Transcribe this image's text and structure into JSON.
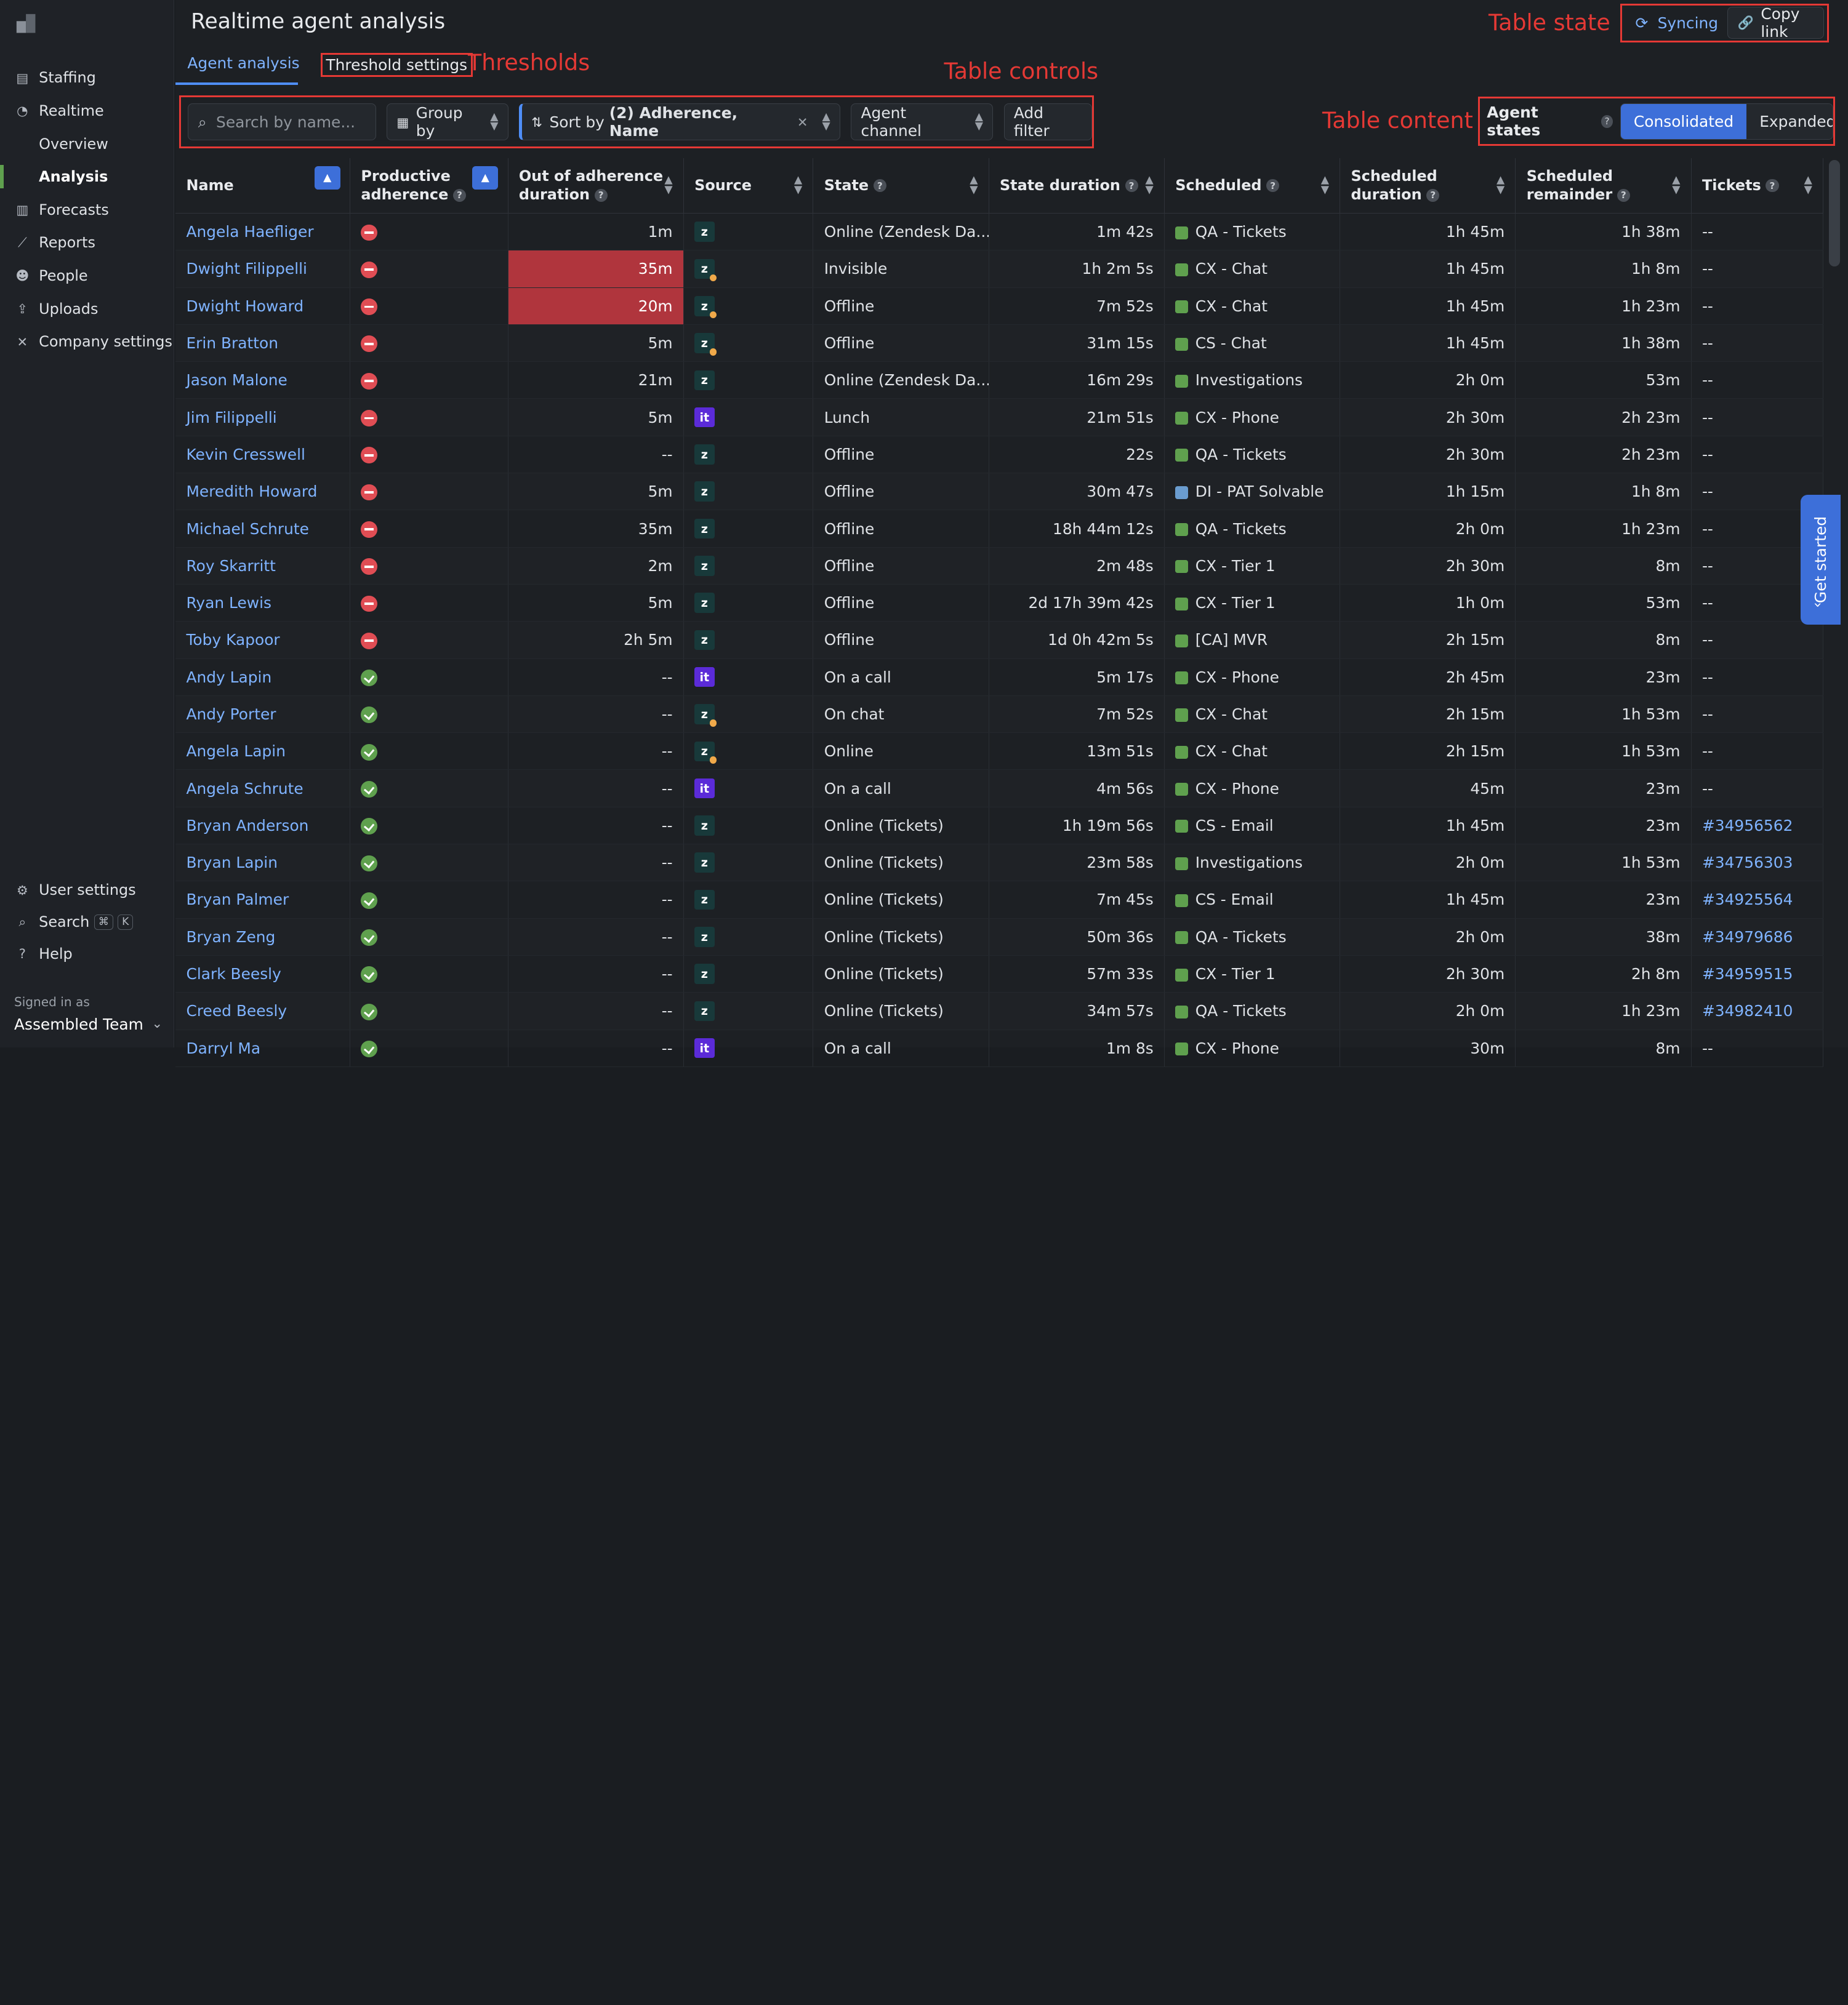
{
  "sidebar": {
    "items": [
      {
        "label": "Staffing",
        "icon": "staffing-icon",
        "glyph": "▤"
      },
      {
        "label": "Realtime",
        "icon": "gauge-icon",
        "glyph": "◔"
      },
      {
        "label": "Overview",
        "sub": true
      },
      {
        "label": "Analysis",
        "sub": true,
        "active": true
      },
      {
        "label": "Forecasts",
        "icon": "book-icon",
        "glyph": "▥"
      },
      {
        "label": "Reports",
        "icon": "chart-icon",
        "glyph": "⟋"
      },
      {
        "label": "People",
        "icon": "people-icon",
        "glyph": "☻"
      },
      {
        "label": "Uploads",
        "icon": "upload-icon",
        "glyph": "⇪"
      },
      {
        "label": "Company settings",
        "icon": "tools-icon",
        "glyph": "✕"
      }
    ],
    "bottom": {
      "user_settings": "User settings",
      "search": "Search",
      "search_kbd1": "⌘",
      "search_kbd2": "K",
      "help": "Help"
    },
    "signed_in_label": "Signed in as",
    "signed_in_name": "Assembled Team"
  },
  "header": {
    "title": "Realtime agent analysis",
    "tab_agent_analysis": "Agent analysis",
    "tab_threshold_settings": "Threshold settings",
    "syncing": "Syncing",
    "copy_link": "Copy link"
  },
  "annotations": {
    "thresholds": "Thresholds",
    "table_controls": "Table controls",
    "table_state": "Table state",
    "table_content": "Table content",
    "color": "#e53935"
  },
  "controls": {
    "search_placeholder": "Search by name...",
    "group_by": "Group by",
    "sort_prefix": "Sort by ",
    "sort_value": "(2) Adherence, Name",
    "agent_channel": "Agent channel",
    "add_filter": "Add filter"
  },
  "agent_states": {
    "label": "Agent states",
    "consolidated": "Consolidated",
    "expanded": "Expanded"
  },
  "table": {
    "headers": {
      "name": "Name",
      "productive_adherence": "Productive adherence",
      "out_of_adherence": "Out of adherence duration",
      "source": "Source",
      "state": "State",
      "state_duration": "State duration",
      "scheduled": "Scheduled",
      "scheduled_duration": "Scheduled duration",
      "scheduled_remainder": "Scheduled remainder",
      "tickets": "Tickets"
    },
    "rows": [
      {
        "name": "Angela Haefliger",
        "adh": "bad",
        "ooa": "1m",
        "hl": false,
        "src": "z",
        "state": "Online (Zendesk Da...",
        "dur": "1m 42s",
        "sched": "QA - Tickets",
        "sc": "green",
        "sdur": "1h 45m",
        "rem": "1h 38m",
        "tix": "--"
      },
      {
        "name": "Dwight Filippelli",
        "adh": "bad",
        "ooa": "35m",
        "hl": true,
        "src": "zs",
        "state": "Invisible",
        "dur": "1h 2m 5s",
        "sched": "CX - Chat",
        "sc": "green",
        "sdur": "1h 45m",
        "rem": "1h 8m",
        "tix": "--"
      },
      {
        "name": "Dwight Howard",
        "adh": "bad",
        "ooa": "20m",
        "hl": true,
        "src": "zs",
        "state": "Offline",
        "dur": "7m 52s",
        "sched": "CX - Chat",
        "sc": "green",
        "sdur": "1h 45m",
        "rem": "1h 23m",
        "tix": "--"
      },
      {
        "name": "Erin Bratton",
        "adh": "bad",
        "ooa": "5m",
        "hl": false,
        "src": "zs",
        "state": "Offline",
        "dur": "31m 15s",
        "sched": "CS - Chat",
        "sc": "green",
        "sdur": "1h 45m",
        "rem": "1h 38m",
        "tix": "--"
      },
      {
        "name": "Jason Malone",
        "adh": "bad",
        "ooa": "21m",
        "hl": false,
        "src": "z",
        "state": "Online (Zendesk Da...",
        "dur": "16m 29s",
        "sched": "Investigations",
        "sc": "green",
        "sdur": "2h 0m",
        "rem": "53m",
        "tix": "--"
      },
      {
        "name": "Jim Filippelli",
        "adh": "bad",
        "ooa": "5m",
        "hl": false,
        "src": "t",
        "state": "Lunch",
        "dur": "21m 51s",
        "sched": "CX - Phone",
        "sc": "green",
        "sdur": "2h 30m",
        "rem": "2h 23m",
        "tix": "--"
      },
      {
        "name": "Kevin Cresswell",
        "adh": "bad",
        "ooa": "--",
        "hl": false,
        "src": "z",
        "state": "Offline",
        "dur": "22s",
        "sched": "QA - Tickets",
        "sc": "green",
        "sdur": "2h 30m",
        "rem": "2h 23m",
        "tix": "--"
      },
      {
        "name": "Meredith Howard",
        "adh": "bad",
        "ooa": "5m",
        "hl": false,
        "src": "z",
        "state": "Offline",
        "dur": "30m 47s",
        "sched": "DI - PAT Solvable",
        "sc": "blue",
        "sdur": "1h 15m",
        "rem": "1h 8m",
        "tix": "--"
      },
      {
        "name": "Michael Schrute",
        "adh": "bad",
        "ooa": "35m",
        "hl": false,
        "src": "z",
        "state": "Offline",
        "dur": "18h 44m 12s",
        "sched": "QA - Tickets",
        "sc": "green",
        "sdur": "2h 0m",
        "rem": "1h 23m",
        "tix": "--"
      },
      {
        "name": "Roy Skarritt",
        "adh": "bad",
        "ooa": "2m",
        "hl": false,
        "src": "z",
        "state": "Offline",
        "dur": "2m 48s",
        "sched": "CX - Tier 1",
        "sc": "green",
        "sdur": "2h 30m",
        "rem": "8m",
        "tix": "--"
      },
      {
        "name": "Ryan Lewis",
        "adh": "bad",
        "ooa": "5m",
        "hl": false,
        "src": "z",
        "state": "Offline",
        "dur": "2d 17h 39m 42s",
        "sched": "CX - Tier 1",
        "sc": "green",
        "sdur": "1h 0m",
        "rem": "53m",
        "tix": "--"
      },
      {
        "name": "Toby Kapoor",
        "adh": "bad",
        "ooa": "2h 5m",
        "hl": false,
        "src": "z",
        "state": "Offline",
        "dur": "1d 0h 42m 5s",
        "sched": "[CA] MVR",
        "sc": "green",
        "sdur": "2h 15m",
        "rem": "8m",
        "tix": "--"
      },
      {
        "name": "Andy Lapin",
        "adh": "good",
        "ooa": "--",
        "hl": false,
        "src": "t",
        "state": "On a call",
        "dur": "5m 17s",
        "sched": "CX - Phone",
        "sc": "green",
        "sdur": "2h 45m",
        "rem": "23m",
        "tix": "--"
      },
      {
        "name": "Andy Porter",
        "adh": "good",
        "ooa": "--",
        "hl": false,
        "src": "zs",
        "state": "On chat",
        "dur": "7m 52s",
        "sched": "CX - Chat",
        "sc": "green",
        "sdur": "2h 15m",
        "rem": "1h 53m",
        "tix": "--"
      },
      {
        "name": "Angela Lapin",
        "adh": "good",
        "ooa": "--",
        "hl": false,
        "src": "zs",
        "state": "Online",
        "dur": "13m 51s",
        "sched": "CX - Chat",
        "sc": "green",
        "sdur": "2h 15m",
        "rem": "1h 53m",
        "tix": "--"
      },
      {
        "name": "Angela Schrute",
        "adh": "good",
        "ooa": "--",
        "hl": false,
        "src": "t",
        "state": "On a call",
        "dur": "4m 56s",
        "sched": "CX - Phone",
        "sc": "green",
        "sdur": "45m",
        "rem": "23m",
        "tix": "--"
      },
      {
        "name": "Bryan Anderson",
        "adh": "good",
        "ooa": "--",
        "hl": false,
        "src": "z",
        "state": "Online (Tickets)",
        "dur": "1h 19m 56s",
        "sched": "CS - Email",
        "sc": "green",
        "sdur": "1h 45m",
        "rem": "23m",
        "tix": "#34956562"
      },
      {
        "name": "Bryan Lapin",
        "adh": "good",
        "ooa": "--",
        "hl": false,
        "src": "z",
        "state": "Online (Tickets)",
        "dur": "23m 58s",
        "sched": "Investigations",
        "sc": "green",
        "sdur": "2h 0m",
        "rem": "1h 53m",
        "tix": "#34756303"
      },
      {
        "name": "Bryan Palmer",
        "adh": "good",
        "ooa": "--",
        "hl": false,
        "src": "z",
        "state": "Online (Tickets)",
        "dur": "7m 45s",
        "sched": "CS - Email",
        "sc": "green",
        "sdur": "1h 45m",
        "rem": "23m",
        "tix": "#34925564"
      },
      {
        "name": "Bryan Zeng",
        "adh": "good",
        "ooa": "--",
        "hl": false,
        "src": "z",
        "state": "Online (Tickets)",
        "dur": "50m 36s",
        "sched": "QA - Tickets",
        "sc": "green",
        "sdur": "2h 0m",
        "rem": "38m",
        "tix": "#34979686"
      },
      {
        "name": "Clark Beesly",
        "adh": "good",
        "ooa": "--",
        "hl": false,
        "src": "z",
        "state": "Online (Tickets)",
        "dur": "57m 33s",
        "sched": "CX - Tier 1",
        "sc": "green",
        "sdur": "2h 30m",
        "rem": "2h 8m",
        "tix": "#34959515"
      },
      {
        "name": "Creed Beesly",
        "adh": "good",
        "ooa": "--",
        "hl": false,
        "src": "z",
        "state": "Online (Tickets)",
        "dur": "34m 57s",
        "sched": "QA - Tickets",
        "sc": "green",
        "sdur": "2h 0m",
        "rem": "1h 23m",
        "tix": "#34982410"
      },
      {
        "name": "Darryl Ma",
        "adh": "good",
        "ooa": "--",
        "hl": false,
        "src": "t",
        "state": "On a call",
        "dur": "1m 8s",
        "sched": "CX - Phone",
        "sc": "green",
        "sdur": "30m",
        "rem": "8m",
        "tix": "--"
      }
    ]
  },
  "get_started": "Get started"
}
